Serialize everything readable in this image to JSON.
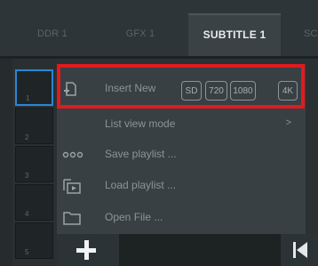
{
  "tabs": [
    {
      "label": "DDR 1"
    },
    {
      "label": "GFX 1"
    },
    {
      "label": "SUBTITLE 1"
    },
    {
      "label": "SC"
    }
  ],
  "slots": [
    {
      "number": "1"
    },
    {
      "number": "2"
    },
    {
      "number": "3"
    },
    {
      "number": "4"
    },
    {
      "number": "5"
    }
  ],
  "menu": {
    "insert_new": {
      "label": "Insert New",
      "icon": "add-file-icon",
      "resolutions": [
        "SD",
        "720",
        "1080",
        "4K"
      ]
    },
    "list_view_mode": {
      "label": "List view mode",
      "arrow": ">"
    },
    "save_playlist": {
      "label": "Save playlist ...",
      "icon": "dots-icon"
    },
    "load_playlist": {
      "label": "Load playlist ...",
      "icon": "playlist-icon"
    },
    "open_file": {
      "label": "Open File ...",
      "icon": "folder-icon"
    }
  },
  "colors": {
    "highlight": "#e11a1e",
    "selected_slot": "#2a86d6"
  }
}
